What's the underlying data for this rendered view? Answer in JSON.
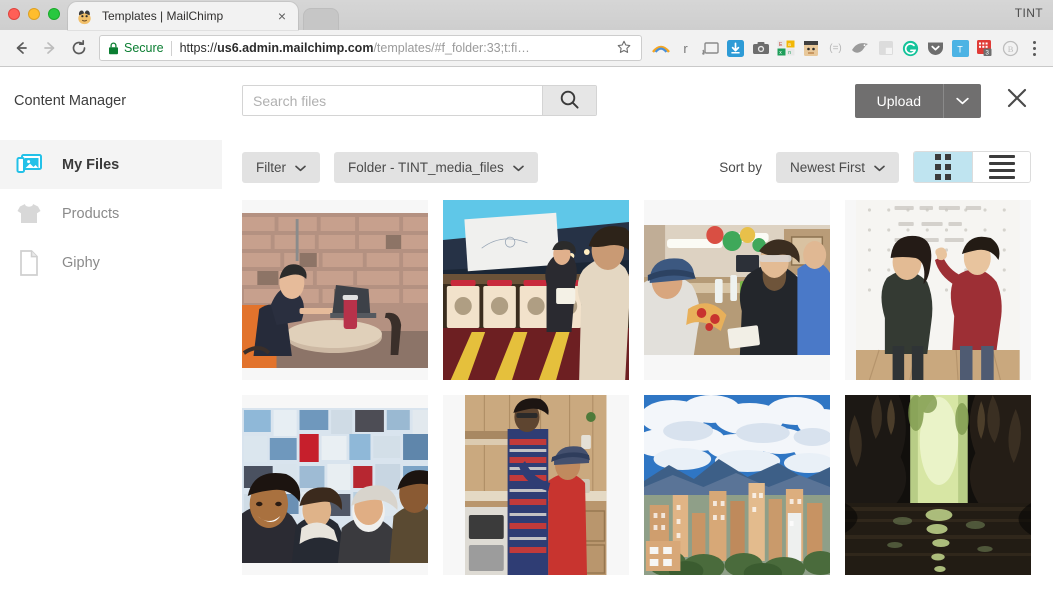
{
  "browser": {
    "window_label": "TINT",
    "tab": {
      "title": "Templates | MailChimp",
      "favicon": "mailchimp-favicon",
      "close": "×"
    },
    "toolbar": {
      "back": "←",
      "forward": "→",
      "reload": "⟳",
      "secure_label": "Secure",
      "url_scheme": "https://",
      "url_host": "us6.admin.mailchimp.com",
      "url_path": "/templates/#f_folder:33;t:fi…",
      "url_full": "https://us6.admin.mailchimp.com/templates/#f_folder:33;t:fi…",
      "bookmark_star": "☆"
    },
    "extensions": [
      "rainbow-arc-icon",
      "letter-r-icon",
      "cast-icon",
      "download-blue-icon",
      "camera-icon",
      "office-suite-icon",
      "avatar-face-icon",
      "equals-brackets-icon",
      "bird-gray-icon",
      "window-gray-icon",
      "grammarly-g-icon",
      "chevron-shield-icon",
      "letter-t-icon",
      "calendar-red-icon",
      "circled-b-icon"
    ],
    "extension_badge": "3",
    "menu": "three-dot-menu"
  },
  "content_manager": {
    "title": "Content Manager",
    "search": {
      "placeholder": "Search files",
      "value": "",
      "button_icon": "search-icon"
    },
    "upload": {
      "label": "Upload",
      "caret": "⌄"
    },
    "close": "×",
    "sidebar": {
      "items": [
        {
          "label": "My Files",
          "icon": "images-icon",
          "active": true
        },
        {
          "label": "Products",
          "icon": "tshirt-icon",
          "active": false
        },
        {
          "label": "Giphy",
          "icon": "file-icon",
          "active": false
        }
      ]
    },
    "toolbar": {
      "filter_label": "Filter",
      "folder_label": "Folder - TINT_media_files",
      "sort_by_label": "Sort by",
      "sort_value": "Newest First",
      "caret": "⌄",
      "view_grid": "grid-view-icon",
      "view_list": "list-view-icon",
      "active_view": "grid"
    },
    "files": [
      {
        "name": "man-working-laptop-brick-wall-cafe",
        "alt": "Man at table with laptop and red cup in front of brick wall"
      },
      {
        "name": "presentation-arcade-bar",
        "alt": "Speaker presenting with projector screen above arcade machines"
      },
      {
        "name": "office-party-coworkers",
        "alt": "Coworkers at a long table in a decorated office"
      },
      {
        "name": "two-people-whiteboard-wall",
        "alt": "Two people standing at a large white pegboard wall"
      },
      {
        "name": "group-selfie-photo-wall",
        "alt": "Group selfie in front of a wall of photographs"
      },
      {
        "name": "two-people-pajamas-kitchen",
        "alt": "Two people in patterned pajamas in a kitchen"
      },
      {
        "name": "city-skyline-mountains-clouds",
        "alt": "City skyline with mountains and dramatic clouds"
      },
      {
        "name": "cave-river-reflection",
        "alt": "Dark cave opening with water reflection and greenery"
      }
    ]
  },
  "colors": {
    "accent_cyan": "#23c1e8",
    "view_active": "#bfe4f0",
    "upload_gray": "#706f6f",
    "pill_gray": "#e2e2e2",
    "tile_gray": "#f7f7f7",
    "secure_green": "#0b7e32"
  }
}
